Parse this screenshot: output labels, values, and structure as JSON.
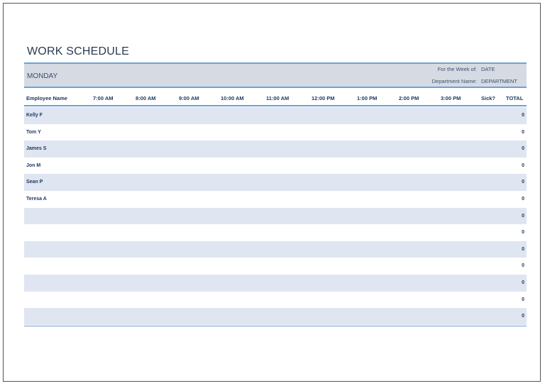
{
  "title": "WORK SCHEDULE",
  "day": "MONDAY",
  "week_label": "For the Week of:",
  "week_value": "DATE",
  "dept_label": "Department Name:",
  "dept_value": "DEPARTMENT",
  "columns": [
    "Employee Name",
    "7:00 AM",
    "8:00 AM",
    "9:00 AM",
    "10:00 AM",
    "11:00 AM",
    "12:00 PM",
    "1:00 PM",
    "2:00 PM",
    "3:00 PM",
    "Sick?",
    "TOTAL"
  ],
  "rows": [
    {
      "name": "Kelly F",
      "total": "0"
    },
    {
      "name": "Tom Y",
      "total": "0"
    },
    {
      "name": "James S",
      "total": "0"
    },
    {
      "name": "Jon M",
      "total": "0"
    },
    {
      "name": "Sean P",
      "total": "0"
    },
    {
      "name": "Teresa A",
      "total": "0"
    },
    {
      "name": "",
      "total": "0"
    },
    {
      "name": "",
      "total": "0"
    },
    {
      "name": "",
      "total": "0"
    },
    {
      "name": "",
      "total": "0"
    },
    {
      "name": "",
      "total": "0"
    },
    {
      "name": "",
      "total": "0"
    },
    {
      "name": "",
      "total": "0"
    }
  ],
  "colors": {
    "band": "#d6dbe3",
    "accent": "#6fa0d6",
    "row_shade": "#dfe5f1",
    "text": "#1f3a63"
  }
}
